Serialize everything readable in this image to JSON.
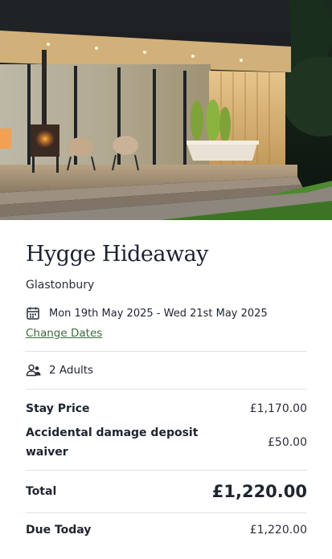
{
  "hero": {
    "image_alt": "Cabin with glass walls, wood burning stove and bath at dusk"
  },
  "property": {
    "name": "Hygge Hideaway",
    "location": "Glastonbury"
  },
  "booking": {
    "dates": "Mon 19th May 2025 - Wed 21st May 2025",
    "change_dates_label": "Change Dates",
    "guests": "2 Adults"
  },
  "pricing": {
    "stay_price_label": "Stay Price",
    "stay_price_value": "£1,170.00",
    "deposit_label": "Accidental damage deposit waiver",
    "deposit_value": "£50.00",
    "total_label": "Total",
    "total_value": "£1,220.00",
    "due_today_label": "Due Today",
    "due_today_value": "£1,220.00"
  },
  "icons": {
    "calendar": "calendar-icon",
    "guests": "guests-icon"
  },
  "colors": {
    "link": "#3b6b3c",
    "text": "#1f2430",
    "divider": "#e1e1e1"
  }
}
